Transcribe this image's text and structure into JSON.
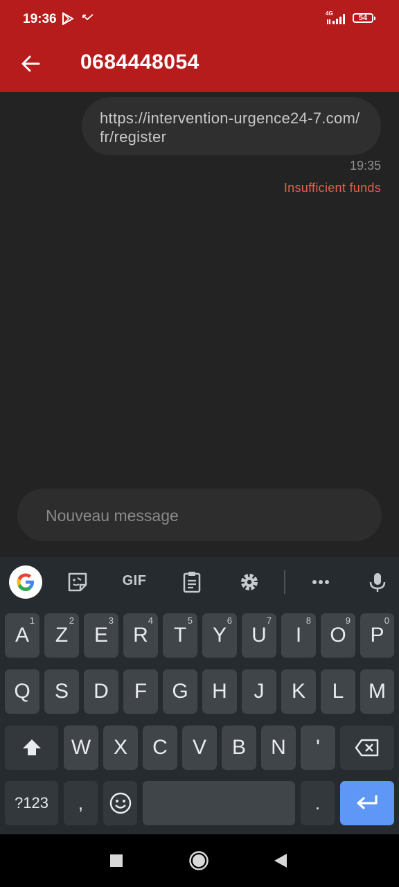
{
  "status_bar": {
    "time": "19:36",
    "network": "4G",
    "battery": "54",
    "icons": [
      "play-store-icon",
      "missed-call-icon",
      "signal-icon",
      "battery-icon"
    ]
  },
  "app_bar": {
    "title": "0684448054",
    "back_icon": "arrow-back-icon",
    "background": "#b71c1c"
  },
  "conversation": {
    "messages": [
      {
        "text": "https://intervention-urgence24-7.com/fr/register",
        "time": "19:35",
        "status": "Insufficient funds"
      }
    ],
    "status_color": "#e4614f"
  },
  "composer": {
    "placeholder": "Nouveau message"
  },
  "keyboard": {
    "toolbar": [
      "google-icon",
      "sticker-icon",
      "GIF",
      "clipboard-icon",
      "gear-icon",
      "more-icon",
      "mic-icon"
    ],
    "gif_label": "GIF",
    "row1": [
      {
        "key": "A",
        "hint": "1"
      },
      {
        "key": "Z",
        "hint": "2"
      },
      {
        "key": "E",
        "hint": "3"
      },
      {
        "key": "R",
        "hint": "4"
      },
      {
        "key": "T",
        "hint": "5"
      },
      {
        "key": "Y",
        "hint": "6"
      },
      {
        "key": "U",
        "hint": "7"
      },
      {
        "key": "I",
        "hint": "8"
      },
      {
        "key": "O",
        "hint": "9"
      },
      {
        "key": "P",
        "hint": "0"
      }
    ],
    "row2": [
      "Q",
      "S",
      "D",
      "F",
      "G",
      "H",
      "J",
      "K",
      "L",
      "M"
    ],
    "row3": [
      "W",
      "X",
      "C",
      "V",
      "B",
      "N",
      "'"
    ],
    "row4": {
      "symbols": "?123",
      "comma": ",",
      "period": ".",
      "emoji_icon": "emoji-icon",
      "enter_icon": "enter-icon",
      "space_icon": "spacebar"
    },
    "accent_color": "#5e97f5"
  },
  "nav_bar": {
    "icons": [
      "recents-square-icon",
      "home-circle-icon",
      "back-triangle-icon"
    ]
  }
}
